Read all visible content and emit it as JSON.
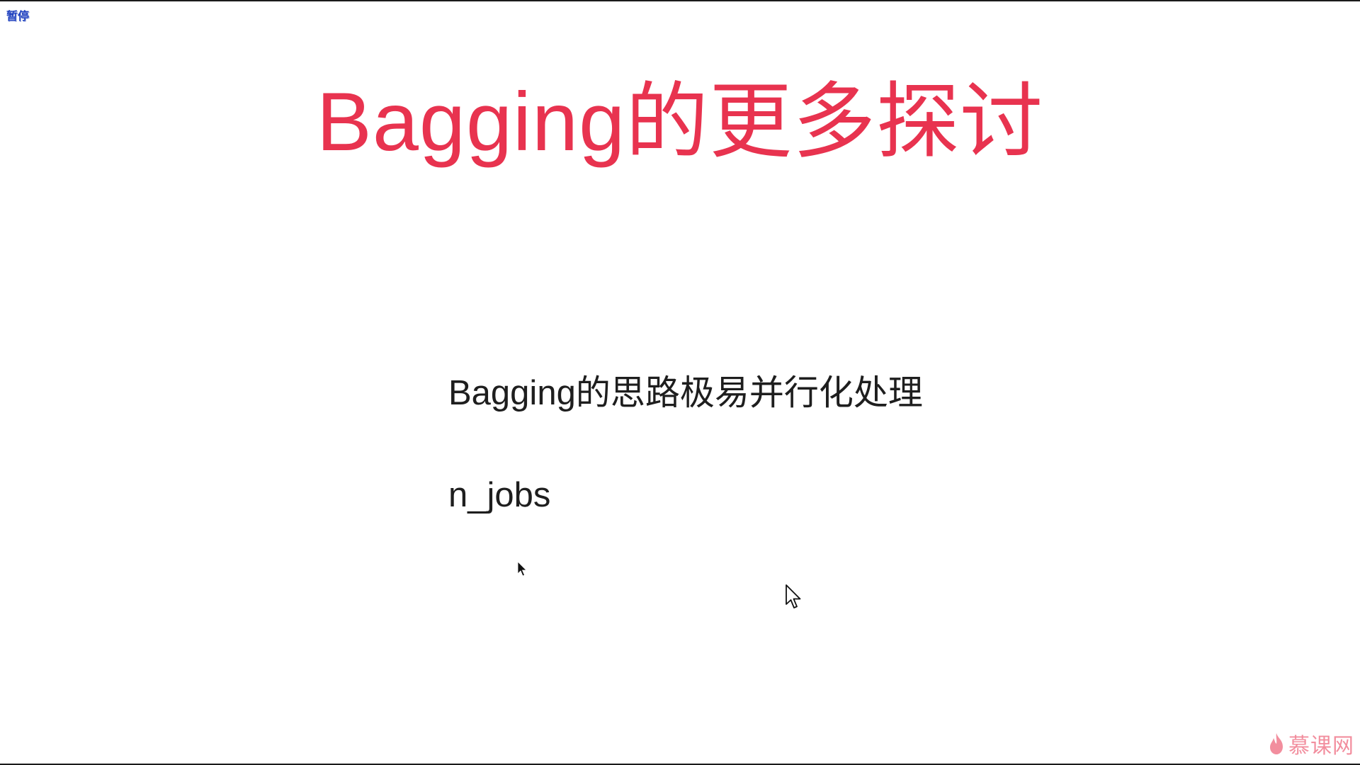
{
  "player": {
    "pause_label": "暂停"
  },
  "slide": {
    "title": "Bagging的更多探讨",
    "bullets": [
      "Bagging的思路极易并行化处理",
      "n_jobs"
    ]
  },
  "watermark": {
    "text": "慕课网",
    "icon": "flame-icon"
  },
  "colors": {
    "title": "#e8334f",
    "body_text": "#1e1e1e",
    "background": "#ffffff",
    "pause_label": "#1d3fbf"
  }
}
